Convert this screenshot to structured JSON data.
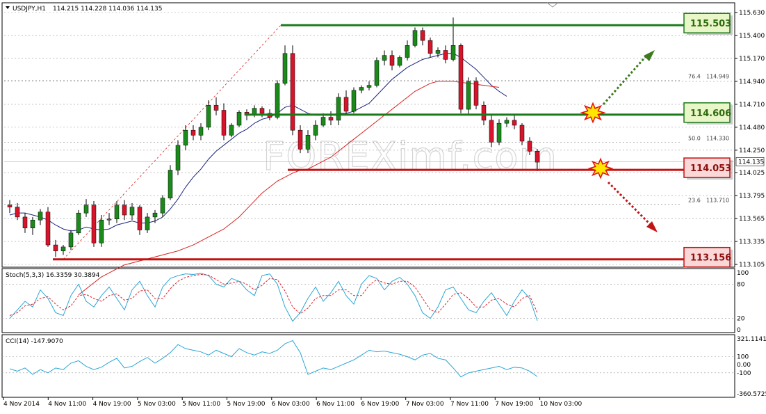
{
  "window": {
    "symbol_header": "USDJPY,H1",
    "ohlc": "114.215 114.228 114.036 114.135"
  },
  "colors": {
    "bull": "#1b8a1b",
    "bear": "#d7142a",
    "ma_fast": "#1a237e",
    "ma_slow": "#d62121",
    "resistance": "#1a7a1a",
    "support": "#c41212",
    "stoch_main": "#2aa6d6",
    "stoch_signal": "#e0202a",
    "cci": "#2aa6d6",
    "resistance_label_bg": "#e9f6c8",
    "support_label_bg": "#fbd8d8"
  },
  "watermark": "FOREXimf.com",
  "levels": [
    {
      "value": 115.503,
      "label": "115.503",
      "kind": "resistance"
    },
    {
      "value": 114.606,
      "label": "114.606",
      "kind": "resistance"
    },
    {
      "value": 114.053,
      "label": "114.053",
      "kind": "support"
    },
    {
      "value": 113.156,
      "label": "113.156",
      "kind": "support"
    }
  ],
  "fibonacci": [
    {
      "ratio": "76.4",
      "price": "114.949"
    },
    {
      "ratio": "50.0",
      "price": "114.330"
    },
    {
      "ratio": "23.6",
      "price": "113.710"
    }
  ],
  "current_price": "114.135",
  "indicators": {
    "stoch": {
      "label": "Stoch(5,3,3) 16.3359 30.3894",
      "ticks": [
        "100",
        "80",
        "20",
        "0"
      ]
    },
    "cci": {
      "label": "CCI(14) -147.9070",
      "ticks": [
        "321.1141",
        "100",
        "0.00",
        "-100",
        "-360.5725"
      ]
    }
  },
  "chart_data": [
    {
      "type": "candlestick",
      "title": "USDJPY,H1",
      "ylim": [
        113.105,
        115.63
      ],
      "y_ticks": [
        "115.630",
        "115.400",
        "115.170",
        "114.940",
        "114.710",
        "114.480",
        "114.250",
        "114.025",
        "113.795",
        "113.565",
        "113.335",
        "113.105"
      ],
      "x_ticks": [
        "4 Nov 2014",
        "4 Nov 11:00",
        "4 Nov 19:00",
        "5 Nov 03:00",
        "5 Nov 11:00",
        "5 Nov 19:00",
        "6 Nov 03:00",
        "6 Nov 11:00",
        "6 Nov 19:00",
        "7 Nov 03:00",
        "7 Nov 11:00",
        "7 Nov 19:00",
        "10 Nov 03:00"
      ],
      "candles": [
        [
          113.7,
          113.75,
          113.62,
          113.68
        ],
        [
          113.68,
          113.72,
          113.55,
          113.58
        ],
        [
          113.58,
          113.62,
          113.42,
          113.47
        ],
        [
          113.47,
          113.58,
          113.4,
          113.55
        ],
        [
          113.55,
          113.66,
          113.5,
          113.63
        ],
        [
          113.63,
          113.68,
          113.28,
          113.3
        ],
        [
          113.3,
          113.35,
          113.18,
          113.24
        ],
        [
          113.24,
          113.3,
          113.2,
          113.28
        ],
        [
          113.28,
          113.45,
          113.25,
          113.42
        ],
        [
          113.42,
          113.65,
          113.4,
          113.62
        ],
        [
          113.62,
          113.76,
          113.58,
          113.7
        ],
        [
          113.7,
          113.74,
          113.28,
          113.32
        ],
        [
          113.32,
          113.6,
          113.28,
          113.55
        ],
        [
          113.55,
          113.62,
          113.5,
          113.56
        ],
        [
          113.56,
          113.74,
          113.52,
          113.7
        ],
        [
          113.7,
          113.75,
          113.55,
          113.6
        ],
        [
          113.6,
          113.72,
          113.55,
          113.68
        ],
        [
          113.68,
          113.7,
          113.4,
          113.45
        ],
        [
          113.45,
          113.62,
          113.42,
          113.58
        ],
        [
          113.58,
          113.65,
          113.52,
          113.62
        ],
        [
          113.62,
          113.8,
          113.58,
          113.77
        ],
        [
          113.77,
          114.1,
          113.75,
          114.05
        ],
        [
          114.05,
          114.35,
          114.0,
          114.3
        ],
        [
          114.3,
          114.5,
          114.25,
          114.45
        ],
        [
          114.45,
          114.5,
          114.35,
          114.4
        ],
        [
          114.4,
          114.52,
          114.35,
          114.48
        ],
        [
          114.48,
          114.75,
          114.45,
          114.7
        ],
        [
          114.7,
          114.78,
          114.6,
          114.65
        ],
        [
          114.65,
          114.72,
          114.35,
          114.4
        ],
        [
          114.4,
          114.52,
          114.38,
          114.5
        ],
        [
          114.5,
          114.65,
          114.48,
          114.63
        ],
        [
          114.63,
          114.66,
          114.55,
          114.6
        ],
        [
          114.6,
          114.7,
          114.58,
          114.67
        ],
        [
          114.67,
          114.69,
          114.58,
          114.62
        ],
        [
          114.62,
          114.66,
          114.55,
          114.58
        ],
        [
          114.58,
          114.95,
          114.56,
          114.92
        ],
        [
          114.92,
          115.3,
          114.9,
          115.22
        ],
        [
          115.22,
          115.3,
          114.4,
          114.45
        ],
        [
          114.45,
          114.5,
          114.22,
          114.26
        ],
        [
          114.26,
          114.45,
          114.22,
          114.4
        ],
        [
          114.4,
          114.55,
          114.35,
          114.5
        ],
        [
          114.5,
          114.62,
          114.48,
          114.58
        ],
        [
          114.58,
          114.64,
          114.5,
          114.55
        ],
        [
          114.55,
          114.82,
          114.5,
          114.78
        ],
        [
          114.78,
          114.85,
          114.6,
          114.64
        ],
        [
          114.64,
          114.88,
          114.62,
          114.85
        ],
        [
          114.85,
          114.9,
          114.82,
          114.88
        ],
        [
          114.88,
          114.94,
          114.85,
          114.9
        ],
        [
          114.9,
          115.18,
          114.88,
          115.15
        ],
        [
          115.15,
          115.25,
          115.1,
          115.2
        ],
        [
          115.2,
          115.25,
          115.05,
          115.1
        ],
        [
          115.1,
          115.2,
          115.08,
          115.18
        ],
        [
          115.18,
          115.35,
          115.15,
          115.3
        ],
        [
          115.3,
          115.48,
          115.28,
          115.45
        ],
        [
          115.45,
          115.48,
          115.3,
          115.35
        ],
        [
          115.35,
          115.38,
          115.18,
          115.22
        ],
        [
          115.22,
          115.28,
          115.18,
          115.25
        ],
        [
          115.25,
          115.3,
          115.12,
          115.16
        ],
        [
          115.16,
          115.58,
          115.14,
          115.3
        ],
        [
          115.3,
          115.32,
          114.62,
          114.66
        ],
        [
          114.66,
          114.98,
          114.6,
          114.94
        ],
        [
          114.94,
          114.98,
          114.66,
          114.7
        ],
        [
          114.7,
          114.74,
          114.5,
          114.55
        ],
        [
          114.55,
          114.6,
          114.28,
          114.33
        ],
        [
          114.33,
          114.56,
          114.3,
          114.52
        ],
        [
          114.52,
          114.58,
          114.48,
          114.55
        ],
        [
          114.55,
          114.6,
          114.46,
          114.5
        ],
        [
          114.5,
          114.52,
          114.3,
          114.34
        ],
        [
          114.34,
          114.38,
          114.2,
          114.24
        ],
        [
          114.24,
          114.26,
          114.04,
          114.13
        ]
      ],
      "series": [
        {
          "name": "MA fast",
          "values": [
            113.6,
            113.62,
            113.62,
            113.6,
            113.58,
            113.55,
            113.5,
            113.46,
            113.44,
            113.45,
            113.48,
            113.46,
            113.45,
            113.46,
            113.5,
            113.52,
            113.54,
            113.52,
            113.52,
            113.54,
            113.58,
            113.66,
            113.76,
            113.88,
            113.98,
            114.06,
            114.16,
            114.24,
            114.3,
            114.36,
            114.42,
            114.46,
            114.52,
            114.56,
            114.58,
            114.62,
            114.68,
            114.7,
            114.66,
            114.62,
            114.6,
            114.6,
            114.6,
            114.62,
            114.62,
            114.64,
            114.68,
            114.72,
            114.8,
            114.88,
            114.96,
            115.02,
            115.08,
            115.12,
            115.16,
            115.18,
            115.2,
            115.22,
            115.22,
            115.18,
            115.12,
            115.06,
            114.98,
            114.9,
            114.84,
            114.79
          ]
        },
        {
          "name": "MA slow",
          "values": [
            112.8,
            112.86,
            112.92,
            112.98,
            113.02,
            113.06,
            113.1,
            113.12,
            113.14,
            113.16,
            113.18,
            113.2,
            113.22,
            113.24,
            113.27,
            113.3,
            113.34,
            113.38,
            113.42,
            113.46,
            113.52,
            113.58,
            113.66,
            113.74,
            113.82,
            113.88,
            113.94,
            113.98,
            114.02,
            114.05,
            114.06,
            114.1,
            114.14,
            114.18,
            114.24,
            114.3,
            114.36,
            114.42,
            114.48,
            114.54,
            114.6,
            114.66,
            114.72,
            114.78,
            114.84,
            114.88,
            114.92,
            114.94,
            114.94,
            114.94,
            114.93,
            114.92,
            114.91,
            114.9,
            114.89,
            114.88
          ]
        }
      ]
    },
    {
      "type": "line",
      "title": "Stoch(5,3,3) 16.3359 30.3894",
      "ylim": [
        0,
        100
      ],
      "series": [
        {
          "name": "Stoch main",
          "values": [
            20,
            35,
            50,
            40,
            70,
            55,
            30,
            25,
            60,
            80,
            50,
            40,
            60,
            75,
            55,
            35,
            70,
            85,
            60,
            40,
            75,
            90,
            95,
            98,
            97,
            99,
            95,
            80,
            75,
            90,
            85,
            70,
            60,
            95,
            98,
            80,
            40,
            15,
            30,
            55,
            75,
            50,
            65,
            85,
            60,
            45,
            80,
            95,
            90,
            70,
            85,
            92,
            80,
            60,
            30,
            20,
            40,
            70,
            75,
            55,
            35,
            30,
            50,
            65,
            45,
            25,
            50,
            70,
            55,
            16
          ]
        },
        {
          "name": "Stoch signal",
          "values": [
            25,
            30,
            42,
            45,
            55,
            58,
            45,
            35,
            42,
            60,
            62,
            55,
            50,
            60,
            63,
            52,
            55,
            68,
            70,
            55,
            55,
            72,
            85,
            92,
            95,
            97,
            96,
            88,
            80,
            82,
            85,
            80,
            70,
            78,
            90,
            88,
            68,
            40,
            28,
            38,
            55,
            60,
            60,
            70,
            70,
            60,
            60,
            78,
            88,
            82,
            80,
            85,
            85,
            75,
            55,
            35,
            30,
            45,
            62,
            65,
            55,
            40,
            40,
            52,
            55,
            45,
            40,
            55,
            60,
            30
          ]
        }
      ]
    },
    {
      "type": "line",
      "title": "CCI(14) -147.9070",
      "ylim": [
        -360.5725,
        321.1141
      ],
      "series": [
        {
          "name": "CCI",
          "values": [
            -50,
            -80,
            -40,
            -120,
            -60,
            -100,
            -40,
            -60,
            20,
            50,
            -20,
            -60,
            -30,
            30,
            80,
            -40,
            -20,
            40,
            90,
            20,
            80,
            150,
            250,
            200,
            180,
            160,
            120,
            180,
            140,
            100,
            200,
            150,
            120,
            160,
            140,
            180,
            260,
            300,
            150,
            -120,
            -80,
            -40,
            -60,
            -20,
            20,
            60,
            120,
            180,
            160,
            170,
            150,
            130,
            100,
            60,
            120,
            140,
            80,
            60,
            -40,
            -150,
            -100,
            -80,
            -60,
            -40,
            -20,
            -60,
            -30,
            -40,
            -80,
            -147
          ]
        }
      ]
    }
  ]
}
